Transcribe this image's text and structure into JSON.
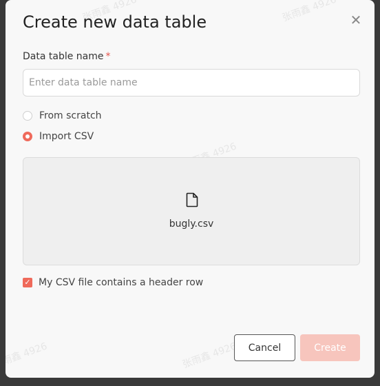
{
  "dialog": {
    "title": "Create new data table",
    "close_icon": "close-icon"
  },
  "name_field": {
    "label": "Data table name",
    "required_mark": "*",
    "placeholder": "Enter data table name",
    "value": ""
  },
  "source_options": [
    {
      "label": "From scratch",
      "checked": false
    },
    {
      "label": "Import CSV",
      "checked": true
    }
  ],
  "dropzone": {
    "icon": "file-icon",
    "file_name": "bugly.csv"
  },
  "header_checkbox": {
    "label": "My CSV file contains a header row",
    "checked": true
  },
  "buttons": {
    "cancel": "Cancel",
    "create": "Create"
  },
  "colors": {
    "accent": "#ef6a5b",
    "accent_disabled": "#f7c5bd"
  },
  "watermark": "张雨鑫 4926"
}
